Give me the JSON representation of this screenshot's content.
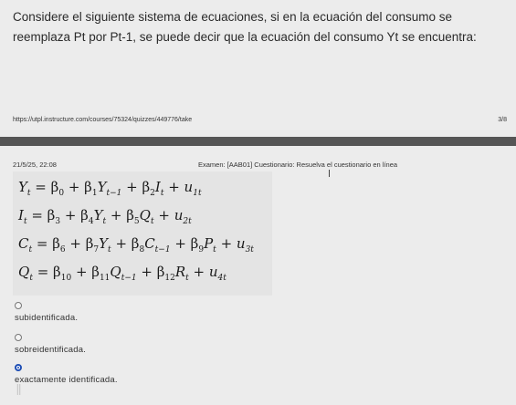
{
  "question": {
    "text": "Considere el siguiente sistema de ecuaciones, si en la ecuación del consumo se reemplaza Pt por Pt-1, se puede decir que la ecuación del consumo Yt se encuentra:"
  },
  "browser": {
    "url": "https://utpl.instructure.com/courses/75324/quizzes/449776/take",
    "page_counter": "3/8"
  },
  "header": {
    "timestamp": "21/5/25, 22:08",
    "exam_title": "Examen: [AAB01] Cuestionario: Resuelva el cuestionario en línea"
  },
  "equations": {
    "eq1": "Y_t = β_0 + β_1 Y_{t−1} + β_2 I_t + u_{1t}",
    "eq2": "I_t = β_3 + β_4 Y_t + β_5 Q_t + u_{2t}",
    "eq3": "C_t = β_6 + β_7 Y_t + β_8 C_{t−1} + β_9 P_t + u_{3t}",
    "eq4": "Q_t = β_10 + β_11 Q_{t−1} + β_12 R_t + u_{4t}"
  },
  "options": [
    {
      "label": "subidentificada.",
      "selected": false
    },
    {
      "label": "sobreidentificada.",
      "selected": false
    },
    {
      "label": "exactamente identificada.",
      "selected": true
    }
  ],
  "colors": {
    "background": "#ececec",
    "divider": "#555555",
    "radio_selected": "#1f4fb5"
  },
  "icons": {
    "drag_handle": "drag-handle-icon"
  }
}
